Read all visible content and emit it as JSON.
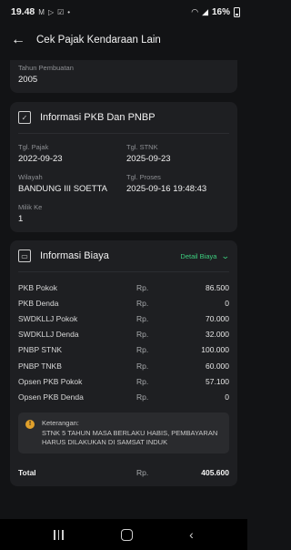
{
  "status_bar": {
    "time": "19.48",
    "battery": "16%"
  },
  "app_bar": {
    "title": "Cek Pajak Kendaraan Lain"
  },
  "vehicle": {
    "tahun_pembuatan_label": "Tahun Pembuatan",
    "tahun_pembuatan": "2005"
  },
  "pkb": {
    "title": "Informasi PKB Dan PNBP",
    "tgl_pajak_label": "Tgl. Pajak",
    "tgl_pajak": "2022-09-23",
    "tgl_stnk_label": "Tgl. STNK",
    "tgl_stnk": "2025-09-23",
    "wilayah_label": "Wilayah",
    "wilayah": "BANDUNG III SOETTA",
    "tgl_proses_label": "Tgl. Proses",
    "tgl_proses": "2025-09-16 19:48:43",
    "milik_ke_label": "Milik Ke",
    "milik_ke": "1"
  },
  "biaya": {
    "title": "Informasi Biaya",
    "detail_label": "Detail Biaya",
    "items": [
      {
        "name": "PKB Pokok",
        "currency": "Rp.",
        "amount": "86.500"
      },
      {
        "name": "PKB Denda",
        "currency": "Rp.",
        "amount": "0"
      },
      {
        "name": "SWDKLLJ Pokok",
        "currency": "Rp.",
        "amount": "70.000"
      },
      {
        "name": "SWDKLLJ Denda",
        "currency": "Rp.",
        "amount": "32.000"
      },
      {
        "name": "PNBP STNK",
        "currency": "Rp.",
        "amount": "100.000"
      },
      {
        "name": "PNBP TNKB",
        "currency": "Rp.",
        "amount": "60.000"
      },
      {
        "name": "Opsen PKB Pokok",
        "currency": "Rp.",
        "amount": "57.100"
      },
      {
        "name": "Opsen PKB Denda",
        "currency": "Rp.",
        "amount": "0"
      }
    ],
    "note_label": "Keterangan:",
    "note_text": "STNK 5 TAHUN MASA BERLAKU HABIS, PEMBAYARAN HARUS DILAKUKAN DI SAMSAT INDUK",
    "total_label": "Total",
    "total_currency": "Rp.",
    "total_amount": "405.600"
  },
  "colors": {
    "background": "#121315",
    "card": "#1e1f22",
    "accent": "#3ccd7e",
    "warning": "#e0a02b"
  }
}
